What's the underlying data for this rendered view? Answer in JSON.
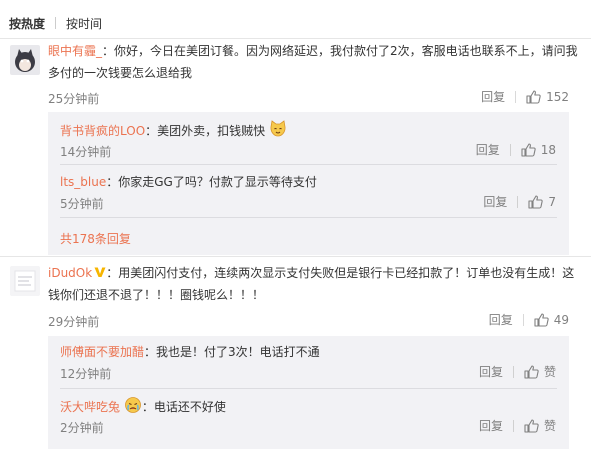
{
  "sort_tabs": {
    "hot": "按热度",
    "time": "按时间"
  },
  "comments": [
    {
      "username": "眼中有霾_",
      "text": "：你好，今日在美团订餐。因为网络延迟，我付款付了2次，客服电话也联系不上，请问我多付的一次钱要怎么退给我",
      "time": "25分钟前",
      "reply_label": "回复",
      "likes": "152",
      "replies": [
        {
          "username": "背书背疯的LOO",
          "text": "：美团外卖，扣钱贼快",
          "emoji": "cat-face-emoji",
          "time": "14分钟前",
          "reply_label": "回复",
          "likes": "18"
        },
        {
          "username": "lts_blue",
          "text": "：你家走GG了吗？付款了显示等待支付",
          "time": "5分钟前",
          "reply_label": "回复",
          "likes": "7"
        }
      ],
      "more_replies": "共178条回复"
    },
    {
      "username": "iDudOk",
      "text": "：用美团闪付支付，连续两次显示支付失败但是银行卡已经扣款了！订单也没有生成！这钱你们还退不退了！！！圈钱呢么！！！",
      "time": "29分钟前",
      "reply_label": "回复",
      "likes": "49",
      "replies": [
        {
          "username": "师傅面不要加醋",
          "text": "：我也是！付了3次！电话打不通",
          "time": "12分钟前",
          "reply_label": "回复",
          "likes": "赞"
        },
        {
          "username": "沃大哔吃兔",
          "text": "：电话还不好使",
          "emoji": "crying-face-emoji",
          "time": "2分钟前",
          "reply_label": "回复",
          "likes": "赞"
        }
      ]
    }
  ],
  "colors": {
    "username": "#eb7350",
    "meta": "#808080",
    "reply_bg": "#f2f2f5",
    "verified": "#f7b500"
  }
}
